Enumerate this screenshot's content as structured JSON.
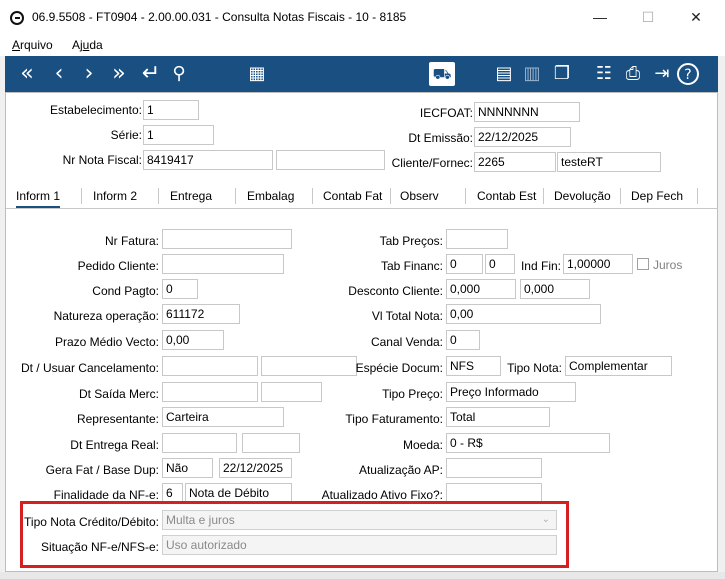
{
  "window": {
    "title": "06.9.5508 - FT0904 - 2.00.00.031 - Consulta Notas Fiscais - 10 - 8185",
    "minimize": "—",
    "maximize": "☐",
    "close": "✕"
  },
  "menu": {
    "arquivo": "Arquivo",
    "ajuda": "Ajuda"
  },
  "toolbar": {
    "first": "«",
    "prev": "‹",
    "next": "›",
    "last": "»",
    "enter": "↵",
    "search": "⚲",
    "grid": "▦",
    "truck": "⛟",
    "book": "▤",
    "chart": "▥",
    "boxes": "❐",
    "tree": "☷",
    "print": "⎙",
    "exit": "⇥",
    "help": "?"
  },
  "header": {
    "estabelecimento_label": "Estabelecimento:",
    "estabelecimento": "1",
    "iecfoat_label": "IECFOAT:",
    "iecfoat": "NNNNNNN",
    "serie_label": "Série:",
    "serie": "1",
    "dt_emissao_label": "Dt Emissão:",
    "dt_emissao": "22/12/2025",
    "nr_nota_label": "Nr Nota Fiscal:",
    "nr_nota": "8419417",
    "nr_nota_extra": "",
    "cliente_label": "Cliente/Fornec:",
    "cliente_code": "2265",
    "cliente_name": "testeRT"
  },
  "tabs": [
    "Inform 1",
    "Inform 2",
    "Entrega",
    "Embalag",
    "Contab Fat",
    "Observ",
    "Contab Est",
    "Devolução",
    "Dep Fech"
  ],
  "form": {
    "nr_fatura_label": "Nr Fatura:",
    "nr_fatura": "",
    "tab_precos_label": "Tab Preços:",
    "tab_precos": "",
    "pedido_cliente_label": "Pedido Cliente:",
    "pedido_cliente": "",
    "tab_financ_label": "Tab Financ:",
    "tab_financ_1": "0",
    "tab_financ_2": "0",
    "ind_fin_label": "Ind Fin:",
    "ind_fin": "1,00000",
    "juros_label": "Juros",
    "cond_pagto_label": "Cond Pagto:",
    "cond_pagto": "0",
    "desconto_cliente_label": "Desconto Cliente:",
    "desconto_1": "0,000",
    "desconto_2": "0,000",
    "natureza_label": "Natureza operação:",
    "natureza": "611172",
    "vl_total_label": "Vl Total Nota:",
    "vl_total": "0,00",
    "prazo_label": "Prazo Médio Vecto:",
    "prazo": "0,00",
    "canal_venda_label": "Canal Venda:",
    "canal_venda": "0",
    "dt_cancel_label": "Dt / Usuar Cancelamento:",
    "dt_cancel_1": "",
    "dt_cancel_2": "",
    "especie_label": "Espécie Docum:",
    "especie": "NFS",
    "tipo_nota_label": "Tipo Nota:",
    "tipo_nota": "Complementar",
    "dt_saida_label": "Dt Saída Merc:",
    "dt_saida_1": "",
    "dt_saida_2": "",
    "tipo_preco_label": "Tipo Preço:",
    "tipo_preco": "Preço Informado",
    "representante_label": "Representante:",
    "representante": "Carteira",
    "tipo_fat_label": "Tipo Faturamento:",
    "tipo_fat": "Total",
    "dt_entrega_label": "Dt Entrega Real:",
    "dt_entrega_1": "",
    "dt_entrega_2": "",
    "moeda_label": "Moeda:",
    "moeda": "0 - R$",
    "gera_fat_label": "Gera Fat / Base Dup:",
    "gera_fat": "Não",
    "base_dup": "22/12/2025",
    "atual_ap_label": "Atualização AP:",
    "atual_ap": "",
    "finalidade_label": "Finalidade da NF-e:",
    "finalidade_code": "6",
    "finalidade_desc": "Nota de Débito",
    "atual_ativo_label": "Atualizado Ativo Fixo?:",
    "atual_ativo": "",
    "tipo_credito_label": "Tipo Nota Crédito/Débito:",
    "tipo_credito": "Multa e juros",
    "situacao_label": "Situação NF-e/NFS-e:",
    "situacao": "Uso autorizado"
  }
}
